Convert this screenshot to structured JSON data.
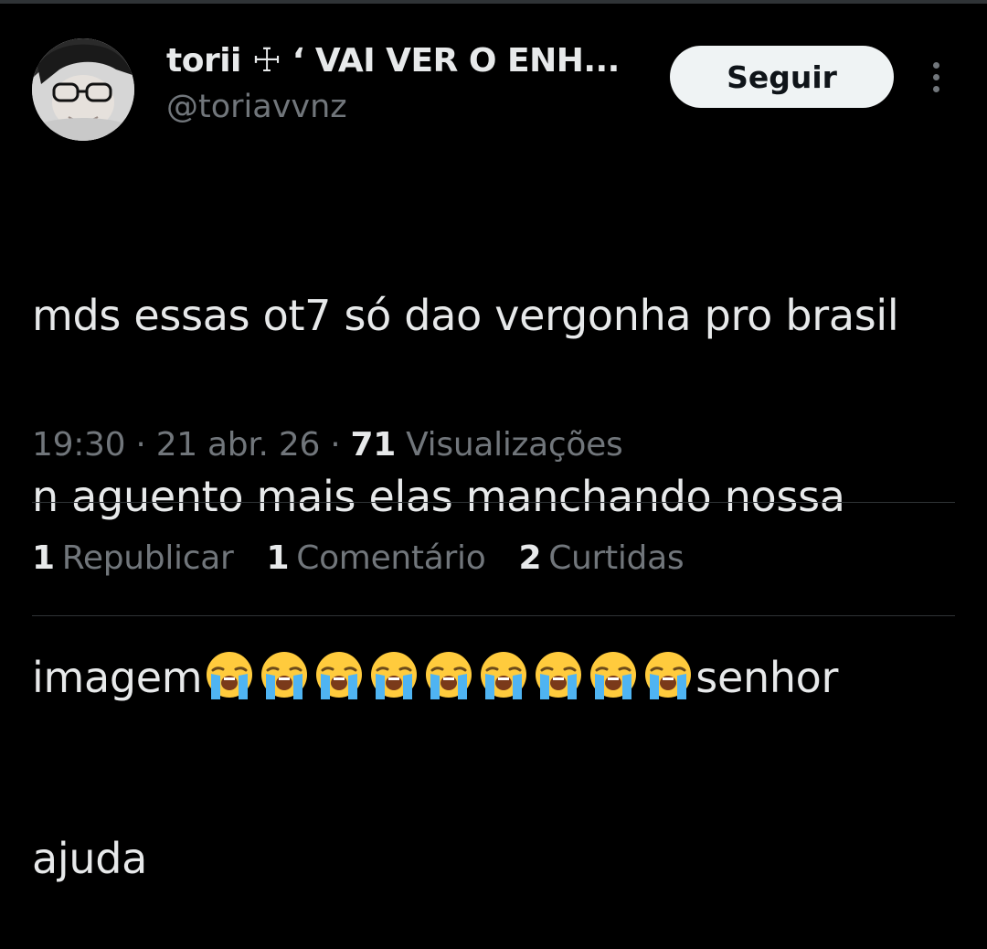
{
  "author": {
    "display_name": "torii ☩ ‘ VAI VER O ENH...",
    "handle": "@toriavvnz"
  },
  "actions": {
    "follow_label": "Seguir",
    "more_icon": "more-vertical-icon"
  },
  "tweet": {
    "line1": "mds essas ot7 só dao vergonha pro brasil",
    "line2": "n aguento mais elas manchando nossa",
    "line3_prefix": "imagem",
    "emoji": "loudly-crying-face",
    "emoji_count": 9,
    "line3_suffix": "senhor",
    "line4": "ajuda"
  },
  "meta": {
    "time": "19:30",
    "separator": " · ",
    "date": "21 abr. 26",
    "views_count": "71",
    "views_label": "Visualizações"
  },
  "stats": {
    "reposts_count": "1",
    "reposts_label": "Republicar",
    "comments_count": "1",
    "comments_label": "Comentário",
    "likes_count": "2",
    "likes_label": "Curtidas"
  },
  "colors": {
    "background": "#000000",
    "text_primary": "#e7e9ea",
    "text_secondary": "#71767b",
    "divider": "#2f3336",
    "button_bg": "#eff3f4"
  }
}
